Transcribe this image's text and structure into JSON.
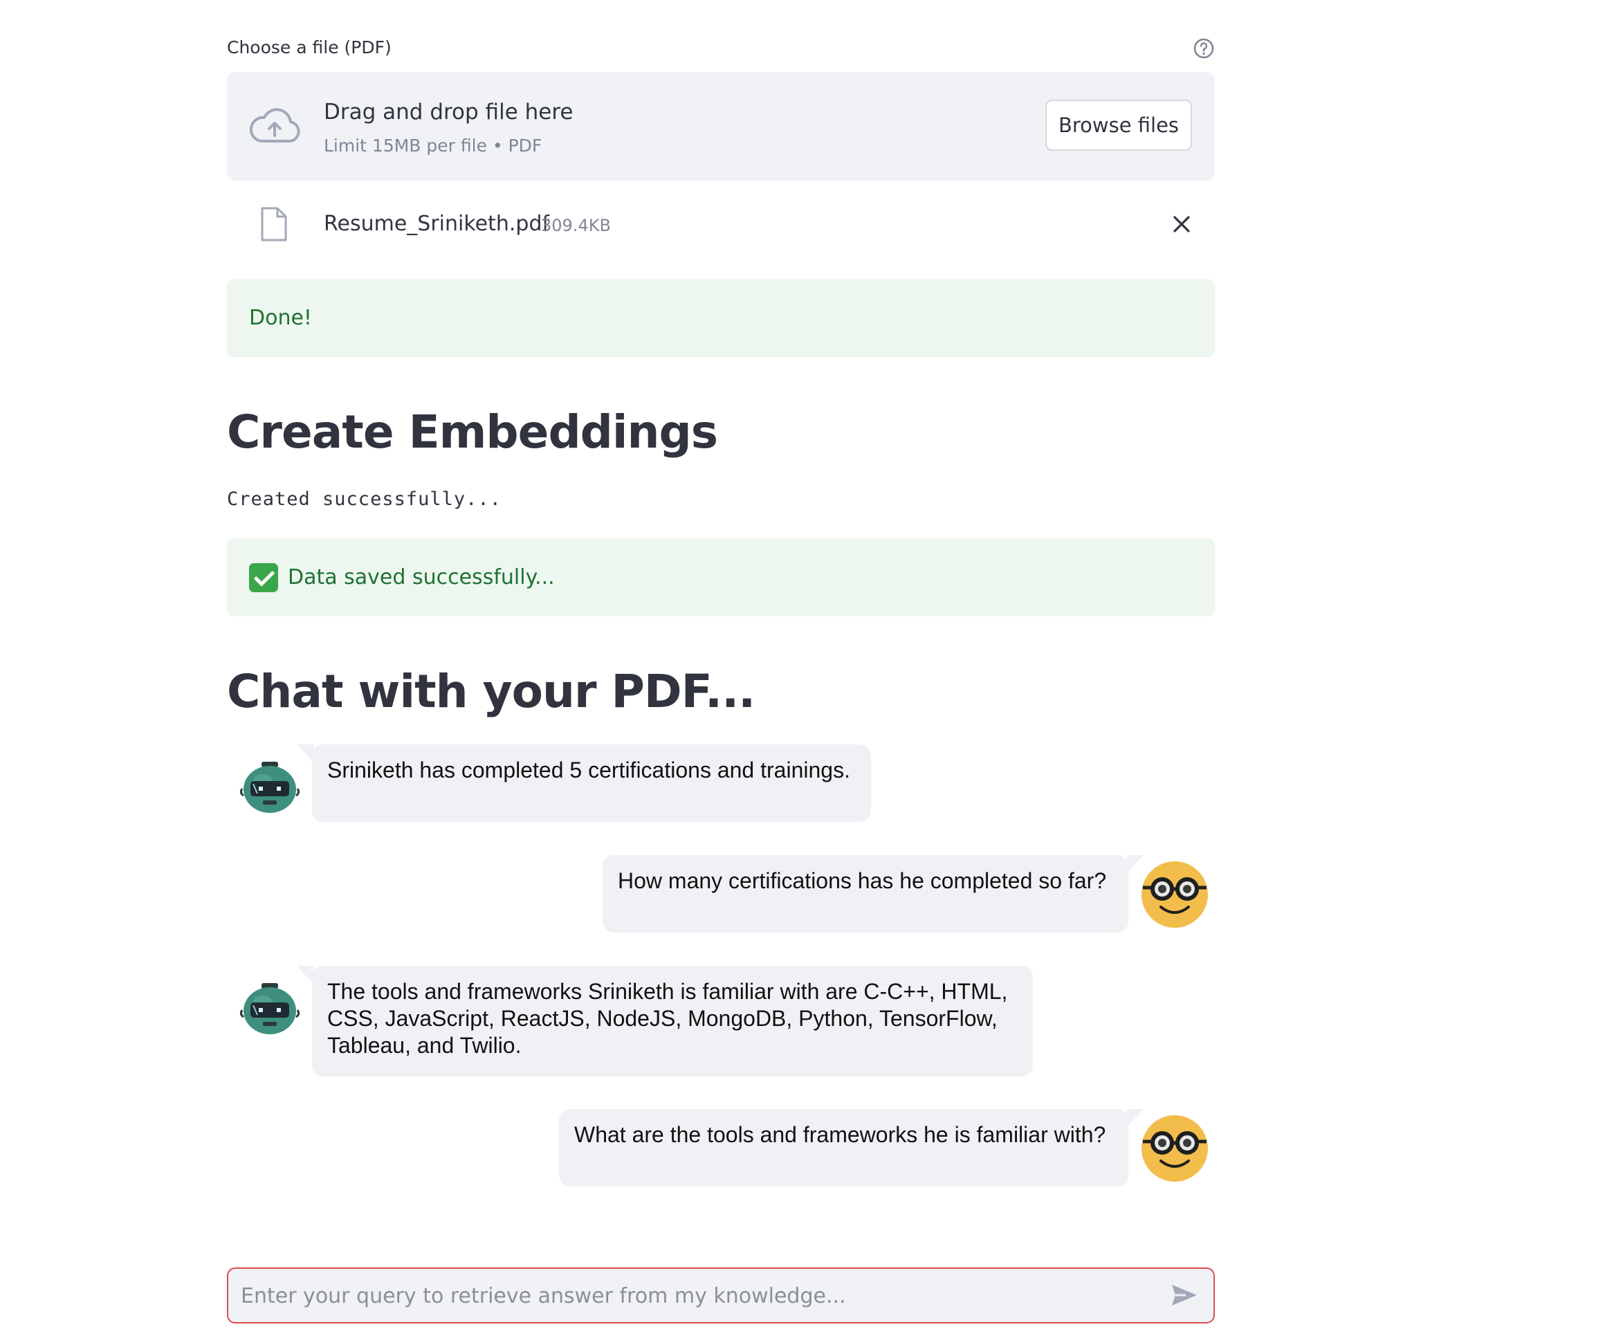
{
  "uploader": {
    "label": "Choose a file (PDF)",
    "drop_title": "Drag and drop file here",
    "drop_subtitle": "Limit 15MB per file • PDF",
    "browse_label": "Browse files",
    "file": {
      "name": "Resume_Sriniketh.pdf",
      "size": "309.4KB"
    }
  },
  "alerts": {
    "done": "Done!",
    "saved": "Data saved successfully..."
  },
  "embeddings": {
    "heading": "Create Embeddings",
    "status": "Created successfully..."
  },
  "chat": {
    "heading": "Chat with your PDF...",
    "messages": [
      {
        "role": "assistant",
        "text": "Sriniketh has completed 5 certifications and trainings."
      },
      {
        "role": "user",
        "text": "How many certifications has he completed so far?"
      },
      {
        "role": "assistant",
        "text": "The tools and frameworks Sriniketh is familiar with are C-C++, HTML, CSS, JavaScript, ReactJS, NodeJS, MongoDB, Python, TensorFlow, Tableau, and Twilio."
      },
      {
        "role": "user",
        "text": "What are the tools and frameworks he is familiar with?"
      }
    ],
    "input_placeholder": "Enter your query to retrieve answer from my knowledge..."
  },
  "icons": {
    "help": "help-circle-icon",
    "upload": "cloud-upload-icon",
    "file": "file-icon",
    "close": "close-icon",
    "check": "check-box-icon",
    "bot_avatar": "robot-avatar",
    "user_avatar": "nerd-face-avatar",
    "send": "send-icon"
  },
  "colors": {
    "alert_bg": "#eef7ef",
    "alert_text": "#1e7234",
    "bubble_bg": "#f0f1f5",
    "input_border": "#e24a4a",
    "user_avatar": "#f2bd4b",
    "bot_avatar": "#3f8f7f"
  }
}
